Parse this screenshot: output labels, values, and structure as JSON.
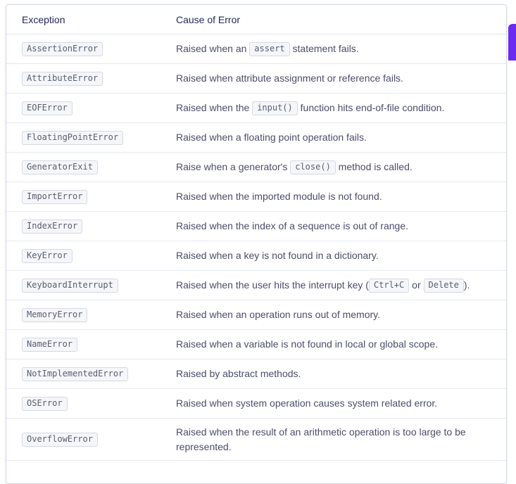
{
  "table": {
    "headers": [
      "Exception",
      "Cause of Error"
    ],
    "rows": [
      {
        "exception": "AssertionError",
        "cause": [
          {
            "t": "Raised when an "
          },
          {
            "c": "assert"
          },
          {
            "t": " statement fails."
          }
        ]
      },
      {
        "exception": "AttributeError",
        "cause": [
          {
            "t": "Raised when attribute assignment or reference fails."
          }
        ]
      },
      {
        "exception": "EOFError",
        "cause": [
          {
            "t": "Raised when the "
          },
          {
            "c": "input()"
          },
          {
            "t": " function hits end-of-file condition."
          }
        ]
      },
      {
        "exception": "FloatingPointError",
        "cause": [
          {
            "t": "Raised when a floating point operation fails."
          }
        ]
      },
      {
        "exception": "GeneratorExit",
        "cause": [
          {
            "t": "Raise when a generator's "
          },
          {
            "c": "close()"
          },
          {
            "t": " method is called."
          }
        ]
      },
      {
        "exception": "ImportError",
        "cause": [
          {
            "t": "Raised when the imported module is not found."
          }
        ]
      },
      {
        "exception": "IndexError",
        "cause": [
          {
            "t": "Raised when the index of a sequence is out of range."
          }
        ]
      },
      {
        "exception": "KeyError",
        "cause": [
          {
            "t": "Raised when a key is not found in a dictionary."
          }
        ]
      },
      {
        "exception": "KeyboardInterrupt",
        "cause": [
          {
            "t": "Raised when the user hits the interrupt key ("
          },
          {
            "c": "Ctrl+C"
          },
          {
            "t": " or "
          },
          {
            "c": "Delete"
          },
          {
            "t": ")."
          }
        ]
      },
      {
        "exception": "MemoryError",
        "cause": [
          {
            "t": "Raised when an operation runs out of memory."
          }
        ]
      },
      {
        "exception": "NameError",
        "cause": [
          {
            "t": "Raised when a variable is not found in local or global scope."
          }
        ]
      },
      {
        "exception": "NotImplementedError",
        "cause": [
          {
            "t": "Raised by abstract methods."
          }
        ]
      },
      {
        "exception": "OSError",
        "cause": [
          {
            "t": "Raised when system operation causes system related error."
          }
        ]
      },
      {
        "exception": "OverflowError",
        "cause": [
          {
            "t": "Raised when the result of an arithmetic operation is too large to be represented."
          }
        ]
      }
    ]
  },
  "colors": {
    "accent": "#6b2bf0",
    "text": "#25265e",
    "code_bg": "#f5f6f9",
    "border": "#d3dae6"
  }
}
